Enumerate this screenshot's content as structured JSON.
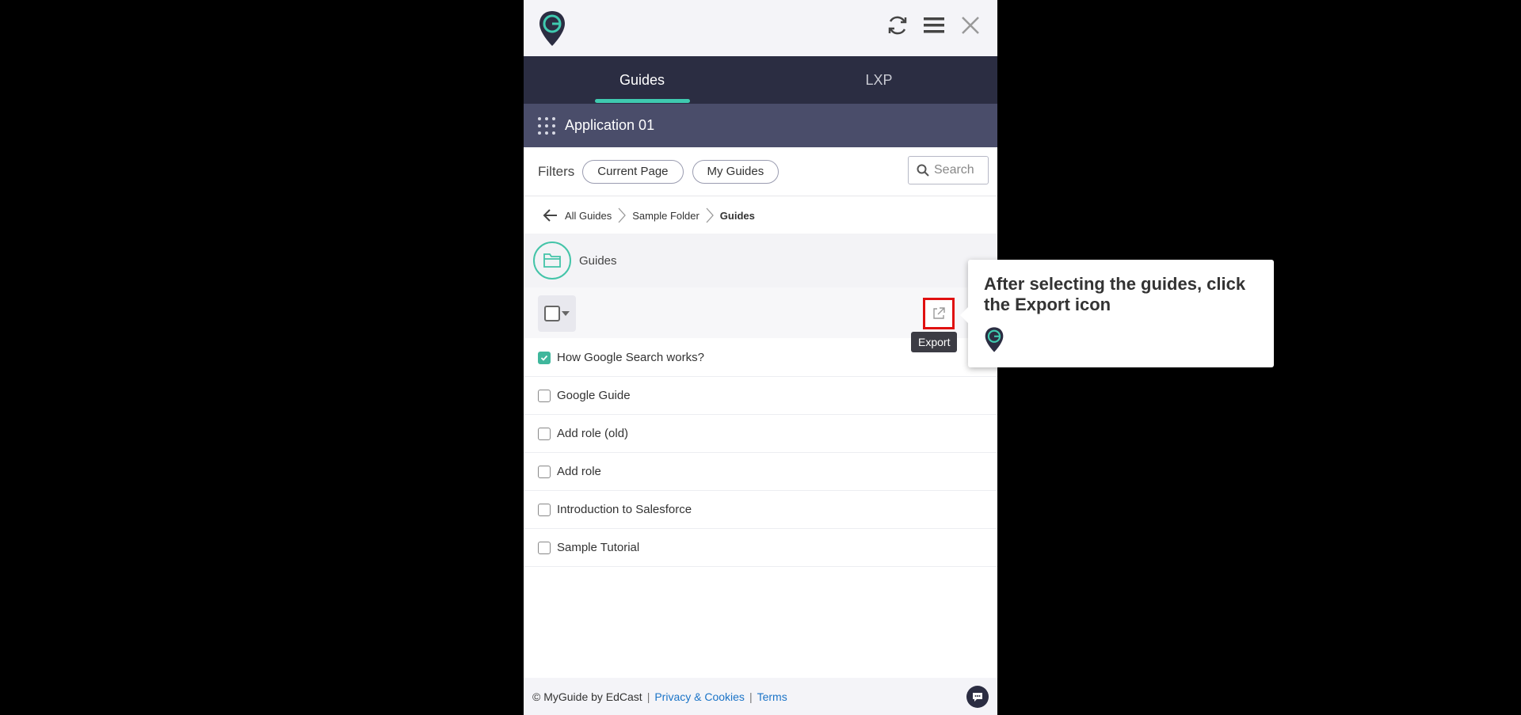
{
  "tabs": [
    {
      "label": "Guides"
    },
    {
      "label": "LXP"
    }
  ],
  "app": {
    "name": "Application 01"
  },
  "filters": {
    "label": "Filters",
    "chips": [
      "Current Page",
      "My Guides"
    ],
    "search_placeholder": "Search"
  },
  "breadcrumb": [
    "All Guides",
    "Sample Folder",
    "Guides"
  ],
  "folder": {
    "name": "Guides"
  },
  "toolbar": {
    "export_tooltip": "Export"
  },
  "guides": [
    {
      "title": "How Google Search works?",
      "checked": true
    },
    {
      "title": "Google Guide",
      "checked": false
    },
    {
      "title": "Add role (old)",
      "checked": false
    },
    {
      "title": "Add role",
      "checked": false
    },
    {
      "title": "Introduction to Salesforce",
      "checked": false
    },
    {
      "title": "Sample Tutorial",
      "checked": false
    }
  ],
  "footer": {
    "copyright": "© MyGuide by EdCast",
    "privacy": "Privacy & Cookies",
    "terms": "Terms",
    "separator": "|"
  },
  "callout": {
    "text": "After selecting the guides, click the Export icon"
  },
  "colors": {
    "accent": "#3fcab0",
    "nav_bg": "#2b2d42",
    "app_bar": "#4a4d6a",
    "highlight": "#e01010",
    "link": "#1b74c7"
  }
}
